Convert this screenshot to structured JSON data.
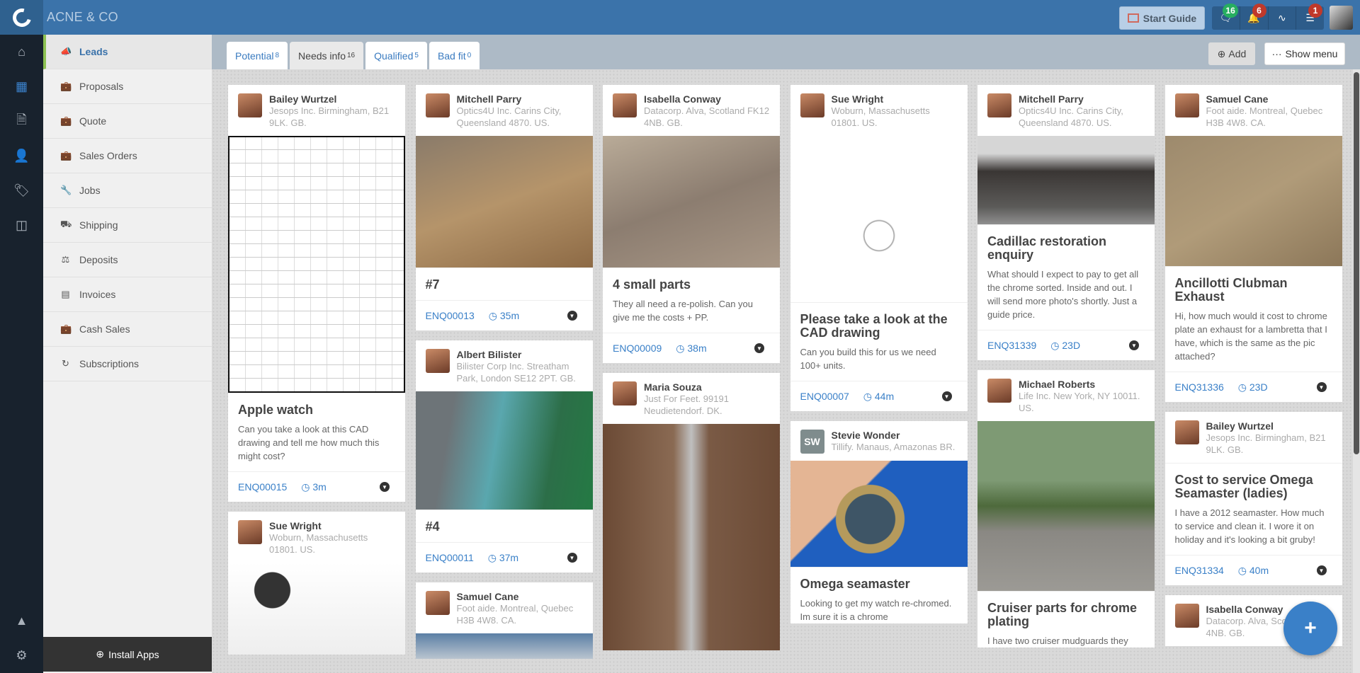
{
  "app": {
    "brand": "ACNE & CO"
  },
  "header": {
    "start_guide": "Start Guide",
    "badges": {
      "messages": "16",
      "notifications": "6",
      "feed": "",
      "tasks": "1"
    },
    "badge_colors": {
      "messages": "#27ae60",
      "notifications": "#c0392b",
      "tasks": "#c0392b"
    }
  },
  "sidebar": {
    "items": [
      {
        "label": "Leads",
        "icon": "megaphone-icon",
        "active": true
      },
      {
        "label": "Proposals",
        "icon": "briefcase-icon"
      },
      {
        "label": "Quote",
        "icon": "briefcase-icon"
      },
      {
        "label": "Sales Orders",
        "icon": "briefcase-icon"
      },
      {
        "label": "Jobs",
        "icon": "wrench-icon"
      },
      {
        "label": "Shipping",
        "icon": "truck-icon"
      },
      {
        "label": "Deposits",
        "icon": "scales-icon"
      },
      {
        "label": "Invoices",
        "icon": "money-icon"
      },
      {
        "label": "Cash Sales",
        "icon": "briefcase-icon"
      },
      {
        "label": "Subscriptions",
        "icon": "refresh-icon"
      }
    ],
    "install_apps": "Install Apps"
  },
  "tabs": [
    {
      "label": "Potential",
      "count": "8"
    },
    {
      "label": "Needs info",
      "count": "16",
      "active": true
    },
    {
      "label": "Qualified",
      "count": "5"
    },
    {
      "label": "Bad fit",
      "count": "0"
    }
  ],
  "toolbar": {
    "add": "Add",
    "show_menu": "Show menu"
  },
  "columns": [
    [
      {
        "name": "Bailey Wurtzel",
        "address": "Jesops Inc. Birmingham, B21 9LK. GB.",
        "image": "cad",
        "title": "Apple watch",
        "text": "Can you take a look at this CAD drawing and tell me how much this might cost?",
        "ref": "ENQ00015",
        "age": "3m"
      },
      {
        "name": "Sue Wright",
        "address": "Woburn, Massachusetts 01801. US.",
        "image": "shower"
      }
    ],
    [
      {
        "name": "Mitchell Parry",
        "address": "Optics4U Inc. Carins City, Queensland 4870. US.",
        "image": "parts1",
        "title": "#7",
        "ref": "ENQ00013",
        "age": "35m"
      },
      {
        "name": "Albert Bilister",
        "address": "Bilister Corp Inc. Streatham Park, London SE12 2PT. GB.",
        "image": "truck",
        "title": "#4",
        "ref": "ENQ00011",
        "age": "37m"
      },
      {
        "name": "Samuel Cane",
        "address": "Foot aide. Montreal, Quebec H3B 4W8. CA.",
        "image": "street"
      }
    ],
    [
      {
        "name": "Isabella Conway",
        "address": "Datacorp. Alva, Scotland FK12 4NB. GB.",
        "image": "parts2",
        "title": "4 small parts",
        "text": "They all need a re-polish. Can you give me the costs + PP.",
        "ref": "ENQ00009",
        "age": "38m"
      },
      {
        "name": "Maria Souza",
        "address": "Just For Feet. 99191 Neudietendorf. DK.",
        "image": "tubes"
      }
    ],
    [
      {
        "name": "Sue Wright",
        "address": "Woburn, Massachusetts 01801. US.",
        "image": "cad2",
        "title": "Please take a look at the CAD drawing",
        "text": "Can you build this for us we need 100+ units.",
        "ref": "ENQ00007",
        "age": "44m"
      },
      {
        "name": "Stevie Wonder",
        "initials": "SW",
        "address": "Tillify. Manaus, Amazonas BR.",
        "image": "watch",
        "title": "Omega seamaster",
        "text": "Looking to get my watch re-chromed. Im sure it is a chrome"
      }
    ],
    [
      {
        "name": "Mitchell Parry",
        "address": "Optics4U Inc. Carins City, Queensland 4870. US.",
        "image": "cadillac",
        "title": "Cadillac restoration enquiry",
        "text": "What should I expect to pay to get all the chrome sorted. Inside and out. I will send more photo's shortly. Just a guide price.",
        "ref": "ENQ31339",
        "age": "23D"
      },
      {
        "name": "Michael Roberts",
        "address": "Life Inc. New York, NY 10011. US.",
        "image": "moto",
        "title": "Cruiser parts for chrome plating",
        "text": "I have two cruiser mudguards they"
      }
    ],
    [
      {
        "name": "Samuel Cane",
        "address": "Foot aide. Montreal, Quebec H3B 4W8. CA.",
        "image": "exhaust",
        "title": "Ancillotti Clubman Exhaust",
        "text": "Hi, how much would it cost to chrome plate an exhaust for a lambretta that I have, which is the same as the pic attached?",
        "ref": "ENQ31336",
        "age": "23D"
      },
      {
        "name": "Bailey Wurtzel",
        "address": "Jesops Inc. Birmingham, B21 9LK. GB.",
        "title": "Cost to service Omega Seamaster (ladies)",
        "text": "I have a 2012 seamaster. How much to service and clean it. I wore it on holiday and it's looking a bit gruby!",
        "ref": "ENQ31334",
        "age": "40m"
      },
      {
        "name": "Isabella Conway",
        "address": "Datacorp. Alva, Scotland FK12 4NB. GB."
      }
    ]
  ]
}
